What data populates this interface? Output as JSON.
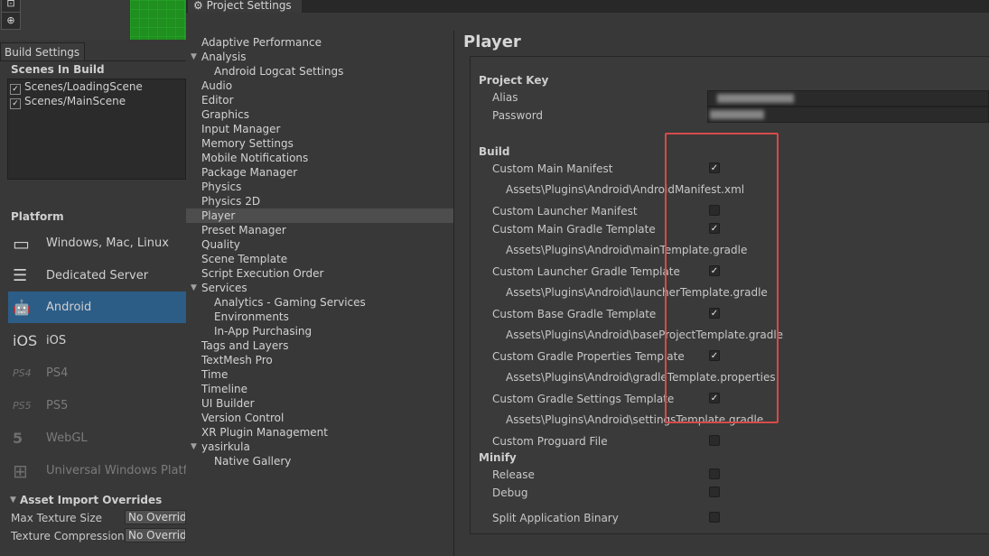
{
  "build_settings": {
    "tab_label": "Build Settings",
    "scenes_header": "Scenes In Build",
    "scenes": [
      "Scenes/LoadingScene",
      "Scenes/MainScene"
    ],
    "platform_header": "Platform",
    "platforms": [
      {
        "label": "Windows, Mac, Linux",
        "icon": "monitor-icon",
        "icon_text": "▭"
      },
      {
        "label": "Dedicated Server",
        "icon": "server-icon",
        "icon_text": "☰"
      },
      {
        "label": "Android",
        "icon": "android-icon",
        "icon_text": "🤖"
      },
      {
        "label": "iOS",
        "icon": "ios-icon",
        "icon_text": "iOS"
      },
      {
        "label": "PS4",
        "icon": "ps4-icon",
        "icon_text": "PS4"
      },
      {
        "label": "PS5",
        "icon": "ps5-icon",
        "icon_text": "PS5"
      },
      {
        "label": "WebGL",
        "icon": "html5-icon",
        "icon_text": "5"
      },
      {
        "label": "Universal Windows Platfo",
        "icon": "windows-icon",
        "icon_text": "⊞"
      }
    ],
    "asset_import_header": "Asset Import Overrides",
    "max_texture_label": "Max Texture Size",
    "max_texture_value": "No Override",
    "texture_compression_label": "Texture Compression",
    "texture_compression_value": "No Override"
  },
  "project_settings": {
    "tab_label": "Project Settings",
    "nav": [
      {
        "label": "Adaptive Performance"
      },
      {
        "label": "Analysis",
        "arrow": "▼"
      },
      {
        "label": "Android Logcat Settings",
        "child": true
      },
      {
        "label": "Audio"
      },
      {
        "label": "Editor"
      },
      {
        "label": "Graphics"
      },
      {
        "label": "Input Manager"
      },
      {
        "label": "Memory Settings"
      },
      {
        "label": "Mobile Notifications"
      },
      {
        "label": "Package Manager"
      },
      {
        "label": "Physics"
      },
      {
        "label": "Physics 2D"
      },
      {
        "label": "Player",
        "selected": true
      },
      {
        "label": "Preset Manager"
      },
      {
        "label": "Quality"
      },
      {
        "label": "Scene Template"
      },
      {
        "label": "Script Execution Order"
      },
      {
        "label": "Services",
        "arrow": "▼"
      },
      {
        "label": "Analytics - Gaming Services",
        "child": true
      },
      {
        "label": "Environments",
        "child": true
      },
      {
        "label": "In-App Purchasing",
        "child": true
      },
      {
        "label": "Tags and Layers"
      },
      {
        "label": "TextMesh Pro"
      },
      {
        "label": "Time"
      },
      {
        "label": "Timeline"
      },
      {
        "label": "UI Builder"
      },
      {
        "label": "Version Control"
      },
      {
        "label": "XR Plugin Management"
      },
      {
        "label": "yasirkula",
        "arrow": "▼"
      },
      {
        "label": "Native Gallery",
        "child": true
      }
    ],
    "player": {
      "title": "Player",
      "project_key_header": "Project Key",
      "alias_label": "Alias",
      "password_label": "Password",
      "build_header": "Build",
      "build_rows": [
        {
          "label": "Custom Main Manifest",
          "checked": true,
          "path": "Assets\\Plugins\\Android\\AndroidManifest.xml"
        },
        {
          "label": "Custom Launcher Manifest",
          "checked": false
        },
        {
          "label": "Custom Main Gradle Template",
          "checked": true,
          "path": "Assets\\Plugins\\Android\\mainTemplate.gradle"
        },
        {
          "label": "Custom Launcher Gradle Template",
          "checked": true,
          "path": "Assets\\Plugins\\Android\\launcherTemplate.gradle"
        },
        {
          "label": "Custom Base Gradle Template",
          "checked": true,
          "path": "Assets\\Plugins\\Android\\baseProjectTemplate.gradle"
        },
        {
          "label": "Custom Gradle Properties Template",
          "checked": true,
          "path": "Assets\\Plugins\\Android\\gradleTemplate.properties"
        },
        {
          "label": "Custom Gradle Settings Template",
          "checked": true,
          "path": "Assets\\Plugins\\Android\\settingsTemplate.gradle"
        },
        {
          "label": "Custom Proguard File",
          "checked": false
        }
      ],
      "minify_header": "Minify",
      "release_label": "Release",
      "debug_label": "Debug",
      "split_label": "Split Application Binary"
    }
  },
  "colors": {
    "selection": "#2c5d87",
    "highlight_box": "#d84a4a",
    "scene_green": "#1f8f1f"
  }
}
